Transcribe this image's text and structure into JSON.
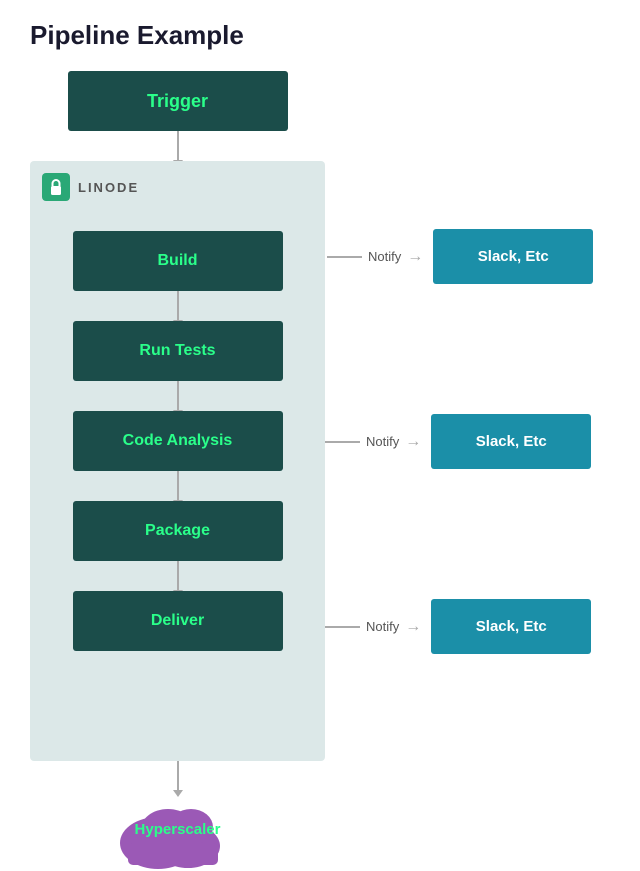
{
  "title": "Pipeline Example",
  "trigger": {
    "label": "Trigger"
  },
  "linode": {
    "label": "LINODE"
  },
  "pipeline_steps": [
    {
      "id": "build",
      "label": "Build",
      "has_notify": true,
      "notify_text": "Notify"
    },
    {
      "id": "run-tests",
      "label": "Run Tests",
      "has_notify": false
    },
    {
      "id": "code-analysis",
      "label": "Code Analysis",
      "has_notify": true,
      "notify_text": "Notify"
    },
    {
      "id": "package",
      "label": "Package",
      "has_notify": false
    },
    {
      "id": "deliver",
      "label": "Deliver",
      "has_notify": true,
      "notify_text": "Notify"
    }
  ],
  "slack_label": "Slack, Etc",
  "hyperscaler_label": "Hyperscaler",
  "notify_positions": {
    "build": 0,
    "code_analysis": 1,
    "deliver": 2
  },
  "colors": {
    "pipeline_box_bg": "#1b4d4a",
    "pipeline_box_text": "#2aff8a",
    "slack_box_bg": "#1b8fa8",
    "linode_bg": "#dce8e8",
    "lock_bg": "#2aa876",
    "cloud_color": "#9b59b6",
    "arrow_color": "#aaaaaa"
  }
}
